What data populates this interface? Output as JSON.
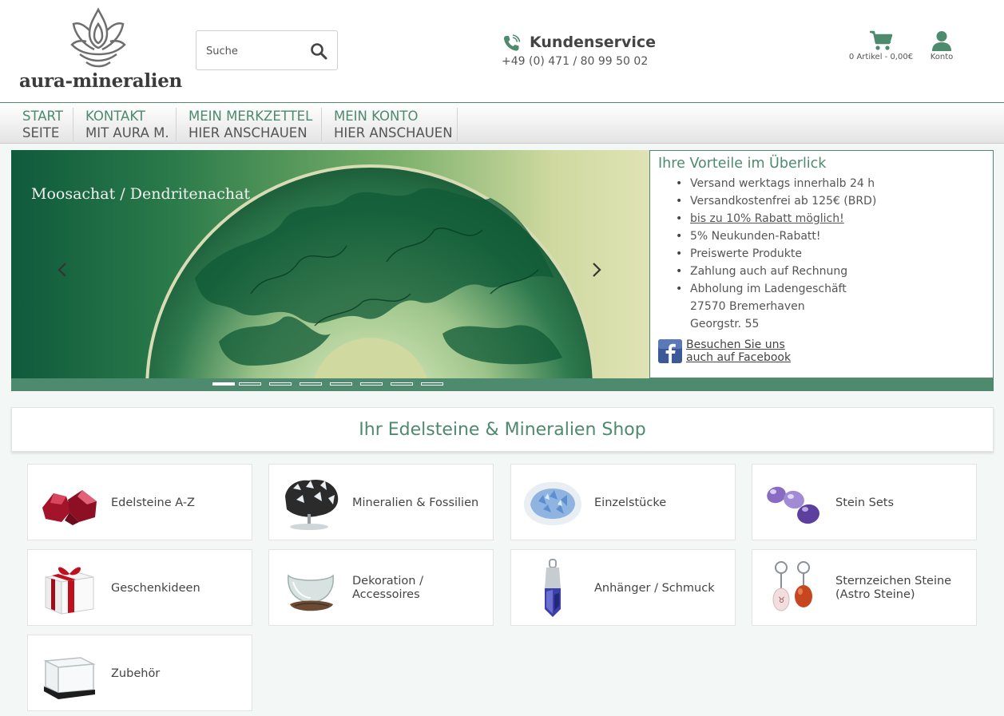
{
  "header": {
    "logo_text": "aura-mineralien",
    "search_placeholder": "Suche",
    "service_title": "Kundenservice",
    "service_phone": "+49 (0) 471 / 80 99 50 02",
    "cart_label": "0 Artikel - 0,00€",
    "account_label": "Konto"
  },
  "nav": [
    {
      "line1": "START",
      "line2": "SEITE"
    },
    {
      "line1": "KONTAKT",
      "line2": "MIT AURA M."
    },
    {
      "line1": "MEIN MERKZETTEL",
      "line2": "HIER ANSCHAUEN"
    },
    {
      "line1": "MEIN KONTO",
      "line2": "HIER ANSCHAUEN"
    }
  ],
  "slider": {
    "caption": "Moosachat / Dendritenachat",
    "slide_count": 8,
    "active_slide": 1
  },
  "benefits": {
    "title": "Ihre Vorteile im Überlick",
    "items": [
      "Versand werktags innerhalb 24 h",
      "Versandkostenfrei ab 125€ (BRD)",
      "bis zu 10% Rabatt möglich!",
      "5% Neukunden-Rabatt!",
      "Preiswerte Produkte",
      "Zahlung auch auf Rechnung",
      "Abholung im Ladengeschäft",
      "27570 Bremerhaven",
      "Georgstr. 55"
    ],
    "facebook_line1": "Besuchen Sie uns",
    "facebook_line2": "auch auf Facebook"
  },
  "shop_title": "Ihr Edelsteine & Mineralien Shop",
  "categories": [
    {
      "label": "Edelsteine A-Z",
      "icon": "red-gemstone-icon"
    },
    {
      "label": "Mineralien & Fossilien",
      "icon": "mineral-specimen-icon"
    },
    {
      "label": "Einzelstücke",
      "icon": "blue-geode-icon"
    },
    {
      "label": "Stein Sets",
      "icon": "amethyst-stones-icon"
    },
    {
      "label": "Geschenkideen",
      "icon": "gift-box-icon"
    },
    {
      "label": "Dekoration / Accessoires",
      "icon": "glass-bowl-icon"
    },
    {
      "label": "Anhänger / Schmuck",
      "icon": "crystal-pendant-icon"
    },
    {
      "label": "Sternzeichen Steine (Astro Steine)",
      "icon": "zodiac-keychain-icon"
    },
    {
      "label": "Zubehör",
      "icon": "display-case-icon"
    }
  ],
  "colors": {
    "accent": "#4e8a6d",
    "text": "#444444",
    "background": "#f3f8f6"
  }
}
